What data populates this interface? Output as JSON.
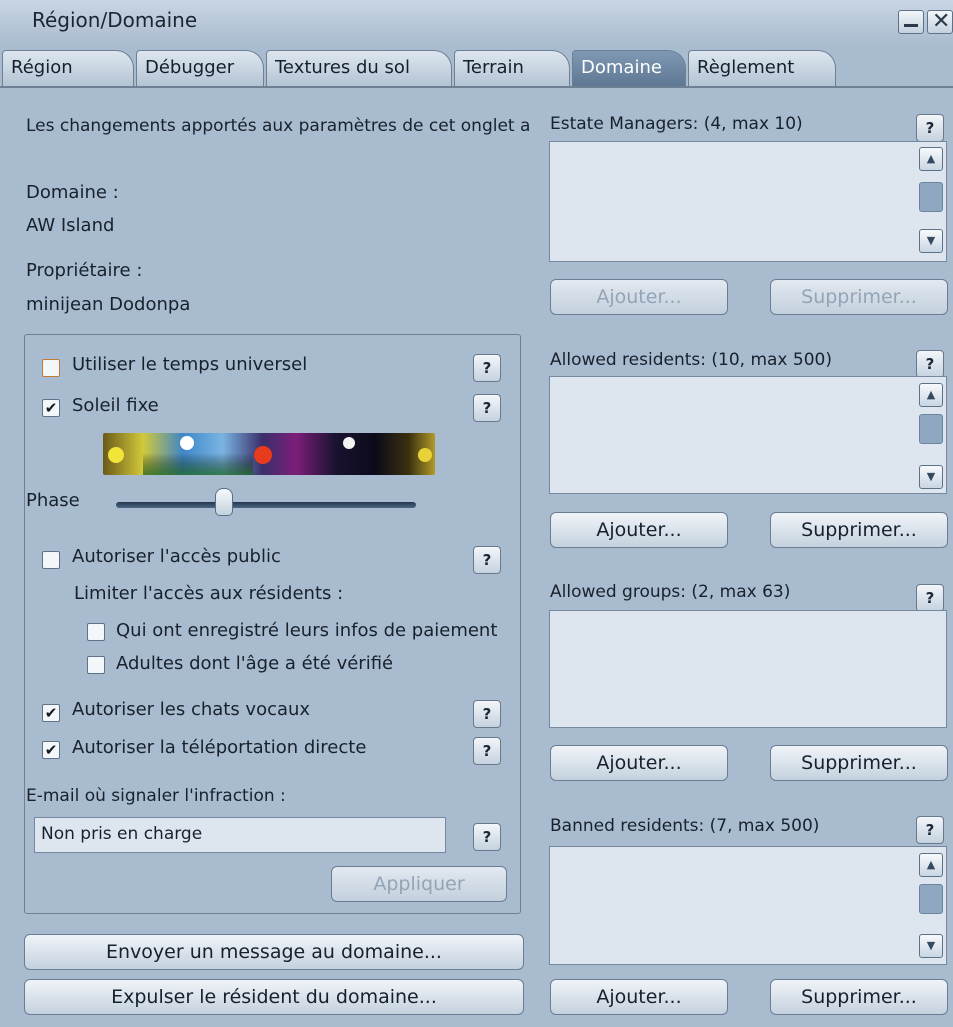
{
  "window": {
    "title": "Région/Domaine"
  },
  "tabs": [
    {
      "label": "Région"
    },
    {
      "label": "Débugger"
    },
    {
      "label": "Textures du sol"
    },
    {
      "label": "Terrain"
    },
    {
      "label": "Domaine",
      "active": true
    },
    {
      "label": "Règlement"
    }
  ],
  "notice": "Les changements apportés aux paramètres de cet onglet a",
  "estate": {
    "label": "Domaine :",
    "name": "AW Island",
    "owner_label": "Propriétaire :",
    "owner_name": "minijean Dodonpa"
  },
  "settings": {
    "universal_time": {
      "label": "Utiliser le temps universel",
      "checked": false
    },
    "fixed_sun": {
      "label": "Soleil fixe",
      "checked": true
    },
    "phase_label": "Phase",
    "phase_level": 0.35,
    "public_access": {
      "label": "Autoriser l'accès public",
      "checked": false
    },
    "limit_label": "Limiter l'accès aux résidents :",
    "payment_info": {
      "label": "Qui ont enregistré leurs infos de paiement",
      "checked": false
    },
    "age_verified": {
      "label": "Adultes dont l'âge a été vérifié",
      "checked": false
    },
    "voice_chat": {
      "label": "Autoriser les chats vocaux",
      "checked": true
    },
    "direct_teleport": {
      "label": "Autoriser la téléportation directe",
      "checked": true
    },
    "email_label": "E-mail où signaler l'infraction :",
    "email_value": "Non pris en charge",
    "apply_label": "Appliquer"
  },
  "help_label": "?",
  "estate_managers": {
    "title": "Estate Managers: (4, max 10)",
    "add": "Ajouter...",
    "remove": "Supprimer..."
  },
  "allowed_residents": {
    "title": "Allowed residents: (10, max 500)",
    "add": "Ajouter...",
    "remove": "Supprimer..."
  },
  "allowed_groups": {
    "title": "Allowed groups: (2, max 63)",
    "add": "Ajouter...",
    "remove": "Supprimer..."
  },
  "banned_residents": {
    "title": "Banned residents: (7, max 500)",
    "add": "Ajouter...",
    "remove": "Supprimer..."
  },
  "actions": {
    "message": "Envoyer un message au domaine...",
    "kick": "Expulser le résident du domaine..."
  },
  "icons": {
    "check": "✔",
    "up": "▲",
    "down": "▼",
    "close": "✕",
    "minimize": "minimize-icon"
  }
}
